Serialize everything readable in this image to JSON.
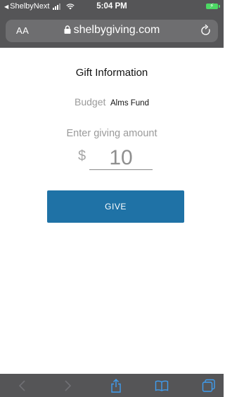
{
  "status_bar": {
    "back_app": "ShelbyNext",
    "time": "5:04 PM"
  },
  "url_bar": {
    "text_size_label": "AA",
    "domain": "shelbygiving.com"
  },
  "gift": {
    "title": "Gift Information",
    "budget_label": "Budget",
    "budget_value": "Alms Fund",
    "amount_prompt": "Enter giving amount",
    "currency_symbol": "$",
    "amount_value": "10",
    "give_label": "GIVE"
  },
  "colors": {
    "chrome": "#555557",
    "url_field": "#6e6e70",
    "give_button": "#1f72a6",
    "battery": "#4cd964",
    "toolbar_icon_active": "#3f9df0",
    "toolbar_icon_disabled": "#707074"
  },
  "toolbar": {
    "icons": [
      "back-icon",
      "forward-icon",
      "share-icon",
      "bookmarks-icon",
      "tabs-icon"
    ]
  }
}
